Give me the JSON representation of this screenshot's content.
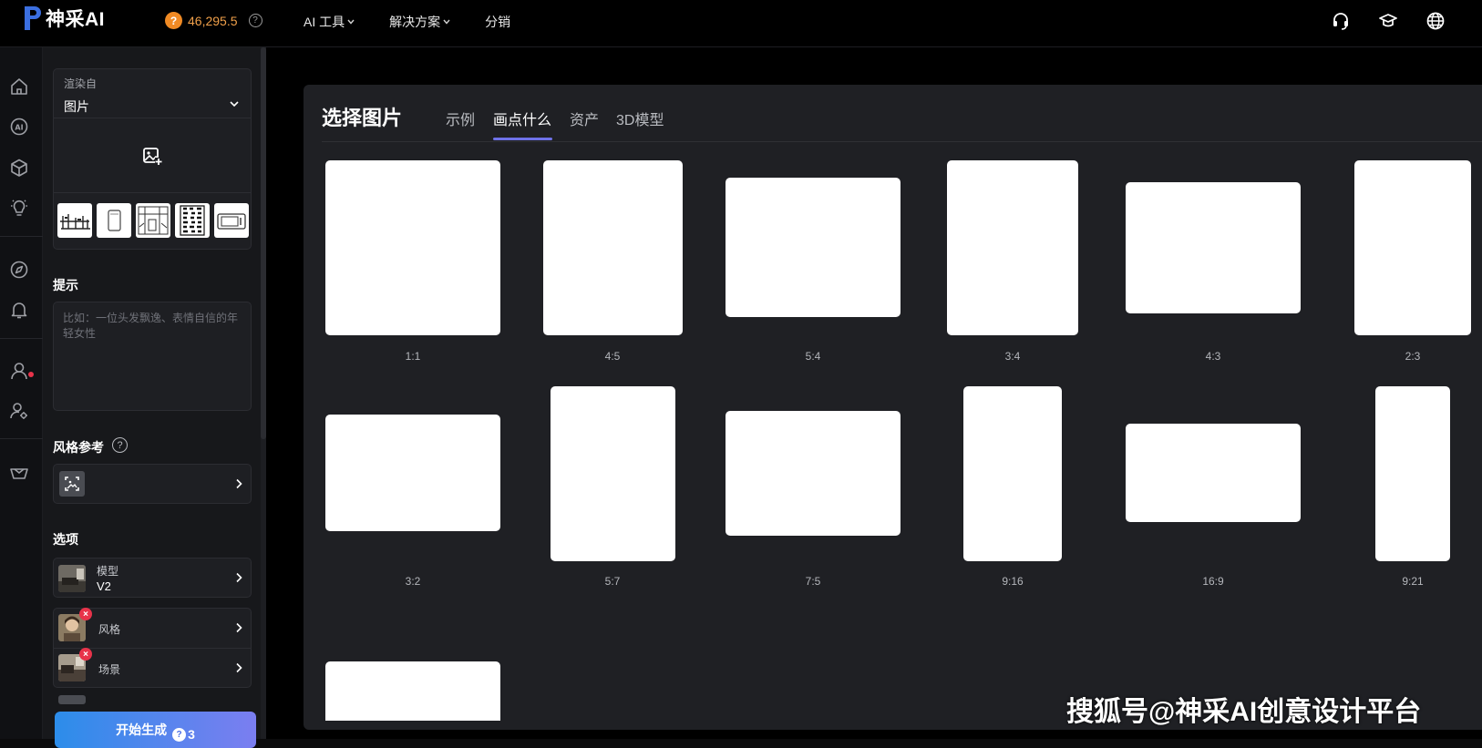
{
  "brand": {
    "name": "神采AI"
  },
  "credits": {
    "value": "46,295.5",
    "coin_glyph": "?",
    "help_glyph": "?"
  },
  "nav": [
    {
      "label": "AI 工具",
      "dropdown": true
    },
    {
      "label": "解决方案",
      "dropdown": true
    },
    {
      "label": "分销",
      "dropdown": false
    }
  ],
  "top_icons": [
    "headset-icon",
    "graduation-cap-icon",
    "globe-icon"
  ],
  "rail_icons": [
    "home-icon",
    "ai-icon",
    "cube-icon",
    "lightbulb-icon",
    "compass-icon",
    "bell-icon",
    "user-icon",
    "user-settings-icon",
    "basket-icon"
  ],
  "left_panel": {
    "render_from": {
      "label": "渲染自",
      "value": "图片"
    },
    "prompt": {
      "title": "提示",
      "placeholder": "比如：一位头发飘逸、表情自信的年轻女性"
    },
    "style_ref": {
      "title": "风格参考",
      "help_glyph": "?"
    },
    "options": {
      "title": "选项",
      "model": {
        "label": "模型",
        "value": "V2"
      },
      "style": {
        "label": "风格"
      },
      "scene": {
        "label": "场景"
      },
      "badge_glyph": "×"
    },
    "generate": {
      "label": "开始生成",
      "cost": "3",
      "coin_glyph": "?"
    }
  },
  "picker": {
    "title": "选择图片",
    "tabs": [
      {
        "label": "示例",
        "active": false
      },
      {
        "label": "画点什么",
        "active": true
      },
      {
        "label": "资产",
        "active": false
      },
      {
        "label": "3D模型",
        "active": false
      }
    ],
    "ratios": [
      "1:1",
      "4:5",
      "5:4",
      "3:4",
      "4:3",
      "2:3",
      "3:2",
      "5:7",
      "7:5",
      "9:16",
      "16:9",
      "9:21",
      ""
    ]
  },
  "watermark": "搜狐号@神采AI创意设计平台",
  "colors": {
    "accent": "#6f72e8",
    "coin": "#f08a24",
    "alert": "#e8334a",
    "panel": "#17181b",
    "picker_bg": "#1f2024"
  }
}
